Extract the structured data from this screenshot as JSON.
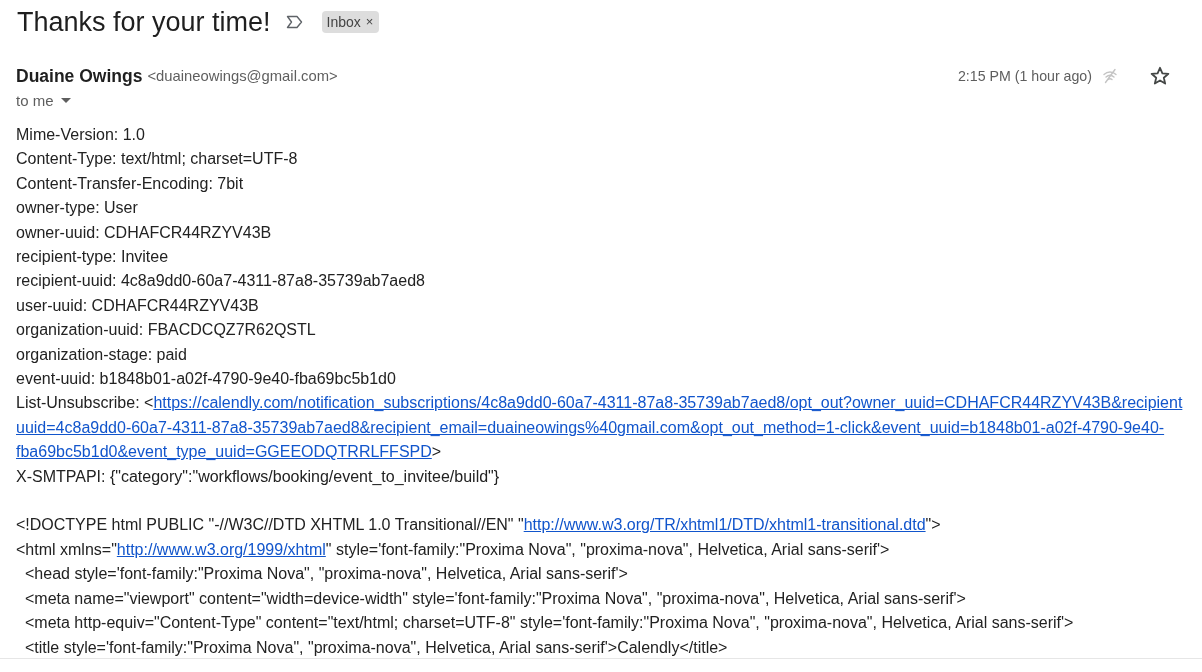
{
  "message": {
    "subject": "Thanks for your time!",
    "important": false,
    "labels": [
      {
        "name": "Inbox",
        "remove": "×"
      }
    ]
  },
  "sender": {
    "name": "Duaine Owings",
    "email": "<duaineowings@gmail.com>",
    "recipients": "to me",
    "time": "2:15 PM (1 hour ago)",
    "starred": false
  },
  "headers": [
    {
      "segments": [
        {
          "kind": "text",
          "text": "Mime-Version: 1.0"
        }
      ]
    },
    {
      "segments": [
        {
          "kind": "text",
          "text": "Content-Type: text/html; charset=UTF-8"
        }
      ]
    },
    {
      "segments": [
        {
          "kind": "text",
          "text": "Content-Transfer-Encoding: 7bit"
        }
      ]
    },
    {
      "segments": [
        {
          "kind": "text",
          "text": "owner-type: User"
        }
      ]
    },
    {
      "segments": [
        {
          "kind": "text",
          "text": "owner-uuid: CDHAFCR44RZYV43B"
        }
      ]
    },
    {
      "segments": [
        {
          "kind": "text",
          "text": "recipient-type: Invitee"
        }
      ]
    },
    {
      "segments": [
        {
          "kind": "text",
          "text": "recipient-uuid: 4c8a9dd0-60a7-4311-87a8-35739ab7aed8"
        }
      ]
    },
    {
      "segments": [
        {
          "kind": "text",
          "text": "user-uuid: CDHAFCR44RZYV43B"
        }
      ]
    },
    {
      "segments": [
        {
          "kind": "text",
          "text": "organization-uuid: FBACDCQZ7R62QSTL"
        }
      ]
    },
    {
      "segments": [
        {
          "kind": "text",
          "text": "organization-stage: paid"
        }
      ]
    },
    {
      "segments": [
        {
          "kind": "text",
          "text": "event-uuid: b1848b01-a02f-4790-9e40-fba69bc5b1d0"
        }
      ]
    },
    {
      "segments": [
        {
          "kind": "text",
          "text": "List-Unsubscribe: <"
        },
        {
          "kind": "link",
          "text": "https://calendly.com/notification_subscriptions/4c8a9dd0-60a7-4311-87a8-35739ab7aed8/opt_out?owner_uuid=CDHAFCR44RZYV43B&recipient"
        }
      ]
    },
    {
      "segments": [
        {
          "kind": "link",
          "text": "uuid=4c8a9dd0-60a7-4311-87a8-35739ab7aed8&recipient_email=duaineowings%40gmail.com&opt_out_method=1-click&event_uuid=b1848b01-a02f-4790-9e40-"
        }
      ]
    },
    {
      "segments": [
        {
          "kind": "link",
          "text": "fba69bc5b1d0&event_type_uuid=GGEEODQTRRLFFSPD"
        },
        {
          "kind": "text",
          "text": ">"
        }
      ]
    },
    {
      "segments": [
        {
          "kind": "text",
          "text": "X-SMTPAPI: {\"category\":\"workflows/booking/event_to_invitee/build\"}"
        }
      ]
    }
  ],
  "source": [
    {
      "segments": [
        {
          "kind": "text",
          "text": "<!DOCTYPE html PUBLIC \"-//W3C//DTD XHTML 1.0 Transitional//EN\" \""
        },
        {
          "kind": "link",
          "text": "http://www.w3.org/TR/xhtml1/DTD/xhtml1-transitional.dtd"
        },
        {
          "kind": "text",
          "text": "\">"
        }
      ]
    },
    {
      "segments": [
        {
          "kind": "text",
          "text": "<html xmlns=\""
        },
        {
          "kind": "link",
          "text": "http://www.w3.org/1999/xhtml"
        },
        {
          "kind": "text",
          "text": "\" style='font-family:\"Proxima Nova\", \"proxima-nova\", Helvetica, Arial sans-serif'>"
        }
      ],
      "children": [
        {
          "segments": [
            {
              "kind": "text",
              "text": "<head style='font-family:\"Proxima Nova\", \"proxima-nova\", Helvetica, Arial sans-serif'>"
            }
          ]
        },
        {
          "segments": [
            {
              "kind": "text",
              "text": "<meta name=\"viewport\" content=\"width=device-width\" style='font-family:\"Proxima Nova\", \"proxima-nova\", Helvetica, Arial sans-serif'>"
            }
          ]
        },
        {
          "segments": [
            {
              "kind": "text",
              "text": "<meta http-equiv=\"Content-Type\" content=\"text/html; charset=UTF-8\" style='font-family:\"Proxima Nova\", \"proxima-nova\", Helvetica, Arial sans-serif'>"
            }
          ]
        },
        {
          "segments": [
            {
              "kind": "text",
              "text": "<title style='font-family:\"Proxima Nova\", \"proxima-nova\", Helvetica, Arial sans-serif'>Calendly</title>"
            }
          ]
        }
      ]
    }
  ]
}
